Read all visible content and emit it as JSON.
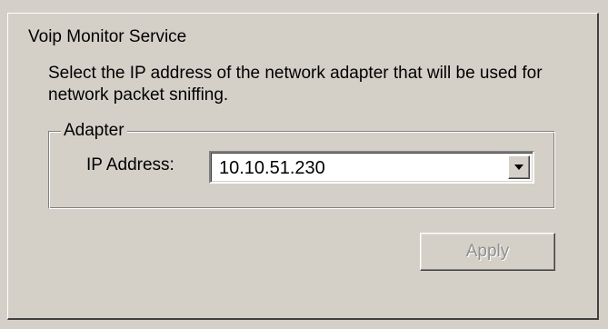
{
  "window": {
    "title": "Voip Monitor Service"
  },
  "content": {
    "description": "Select the IP address of the network adapter that will be used for network packet sniffing."
  },
  "adapter_group": {
    "legend": "Adapter",
    "ip_label": "IP Address:",
    "ip_selected": "10.10.51.230"
  },
  "actions": {
    "apply_label": "Apply",
    "apply_enabled": false
  },
  "icons": {
    "combo_arrow": "chevron-down-icon"
  }
}
